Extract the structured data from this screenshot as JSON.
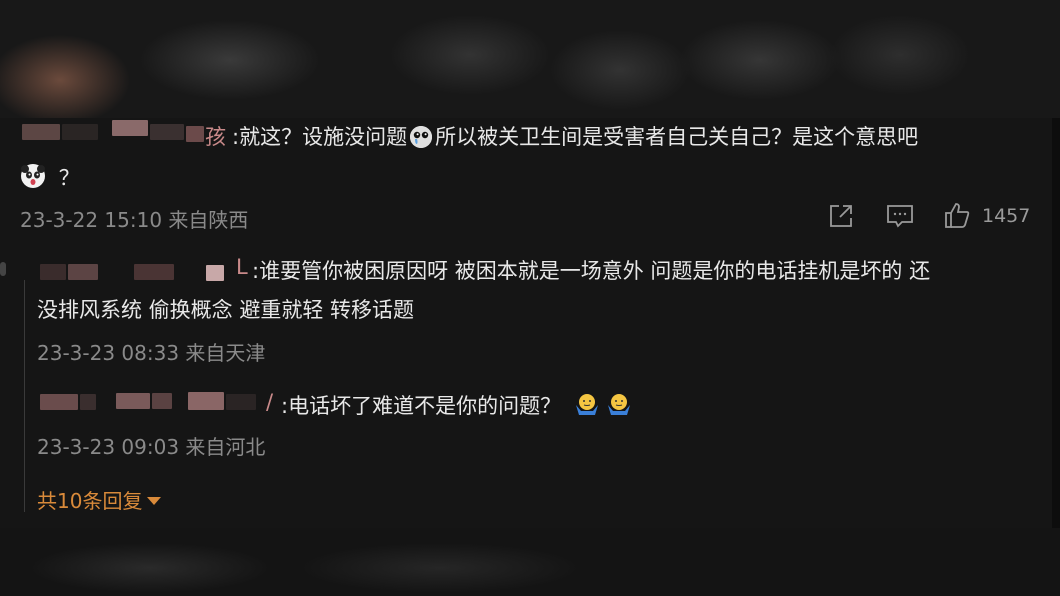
{
  "main_comment": {
    "author_suffix": "孩",
    "text_line1": ":就这？设施没问题",
    "text_line1_after_emoji": "所以被关卫生间是受害者自己关自己？是这个意思吧",
    "text_line2": "？",
    "meta": "23-3-22 15:10 来自陕西",
    "like_count": "1457",
    "icons": [
      "share-icon",
      "comment-icon",
      "like-icon"
    ]
  },
  "reply1": {
    "author_suffix": "L",
    "text_line1": ":谁要管你被困原因呀 被困本就是一场意外 问题是你的电话挂机是坏的 还",
    "text_line2": "没排风系统 偷换概念 避重就轻 转移话题",
    "meta": "23-3-23 08:33 来自天津"
  },
  "reply2": {
    "author_suffix": "/",
    "text": ":电话坏了难道不是你的问题？",
    "meta": "23-3-23 09:03 来自河北"
  },
  "more_replies": {
    "label": "共10条回复",
    "color": "#d98a3a"
  },
  "colors": {
    "background": "#151515",
    "text": "#e8e8e8",
    "meta": "#8a8a8a",
    "accent": "#d98a3a"
  }
}
